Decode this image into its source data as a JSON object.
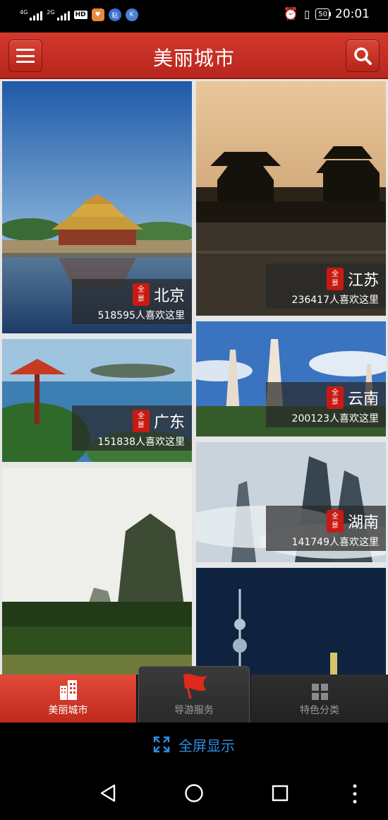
{
  "status_bar": {
    "signal1_label": "4G",
    "signal2_label": "2G",
    "hd_label": "HD",
    "app_icon_2_text": "贴",
    "app_icon_3_text": "K",
    "battery_level": "50",
    "time": "20:01"
  },
  "header": {
    "title": "美丽城市"
  },
  "cities": [
    {
      "name": "北京",
      "likes": "518595人喜欢这里"
    },
    {
      "name": "江苏",
      "likes": "236417人喜欢这里"
    },
    {
      "name": "广东",
      "likes": "151838人喜欢这里"
    },
    {
      "name": "云南",
      "likes": "200123人喜欢这里"
    },
    {
      "name": "湖南",
      "likes": "141749人喜欢这里"
    }
  ],
  "seal_text": [
    "全",
    "景"
  ],
  "tabs": [
    {
      "label": "美丽城市",
      "icon": "building-icon",
      "active": true
    },
    {
      "label": "导游服务",
      "icon": "flag-icon",
      "active": false
    },
    {
      "label": "特色分类",
      "icon": "grid-icon",
      "active": false
    }
  ],
  "fullscreen_label": "全屏显示",
  "colors": {
    "header_red": "#c5301f",
    "active_tab_red": "#d63a2a",
    "link_blue": "#2d8ddc"
  }
}
